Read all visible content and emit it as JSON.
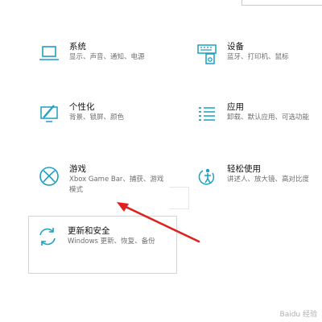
{
  "colors": {
    "accent": "#1c9fc4",
    "annotation_arrow": "#e02020",
    "text_primary": "#111111",
    "text_secondary": "#6e6e6e"
  },
  "tiles": [
    {
      "title": "系统",
      "desc": "显示、声音、通知、电源",
      "icon": "laptop-icon"
    },
    {
      "title": "设备",
      "desc": "蓝牙、打印机、鼠标",
      "icon": "devices-icon"
    },
    {
      "title": "个性化",
      "desc": "背景、锁屏、颜色",
      "icon": "personalization-icon"
    },
    {
      "title": "应用",
      "desc": "卸载、默认应用、可选功能",
      "icon": "apps-list-icon"
    },
    {
      "title": "游戏",
      "desc": "Xbox Game Bar、捕获、游戏模式",
      "icon": "xbox-icon"
    },
    {
      "title": "轻松使用",
      "desc": "讲述人、放大镜、高对比度",
      "icon": "ease-of-access-icon"
    },
    {
      "title": "更新和安全",
      "desc": "Windows 更新、恢复、备份",
      "icon": "update-sync-icon"
    }
  ],
  "watermark": "Baidu 经验"
}
